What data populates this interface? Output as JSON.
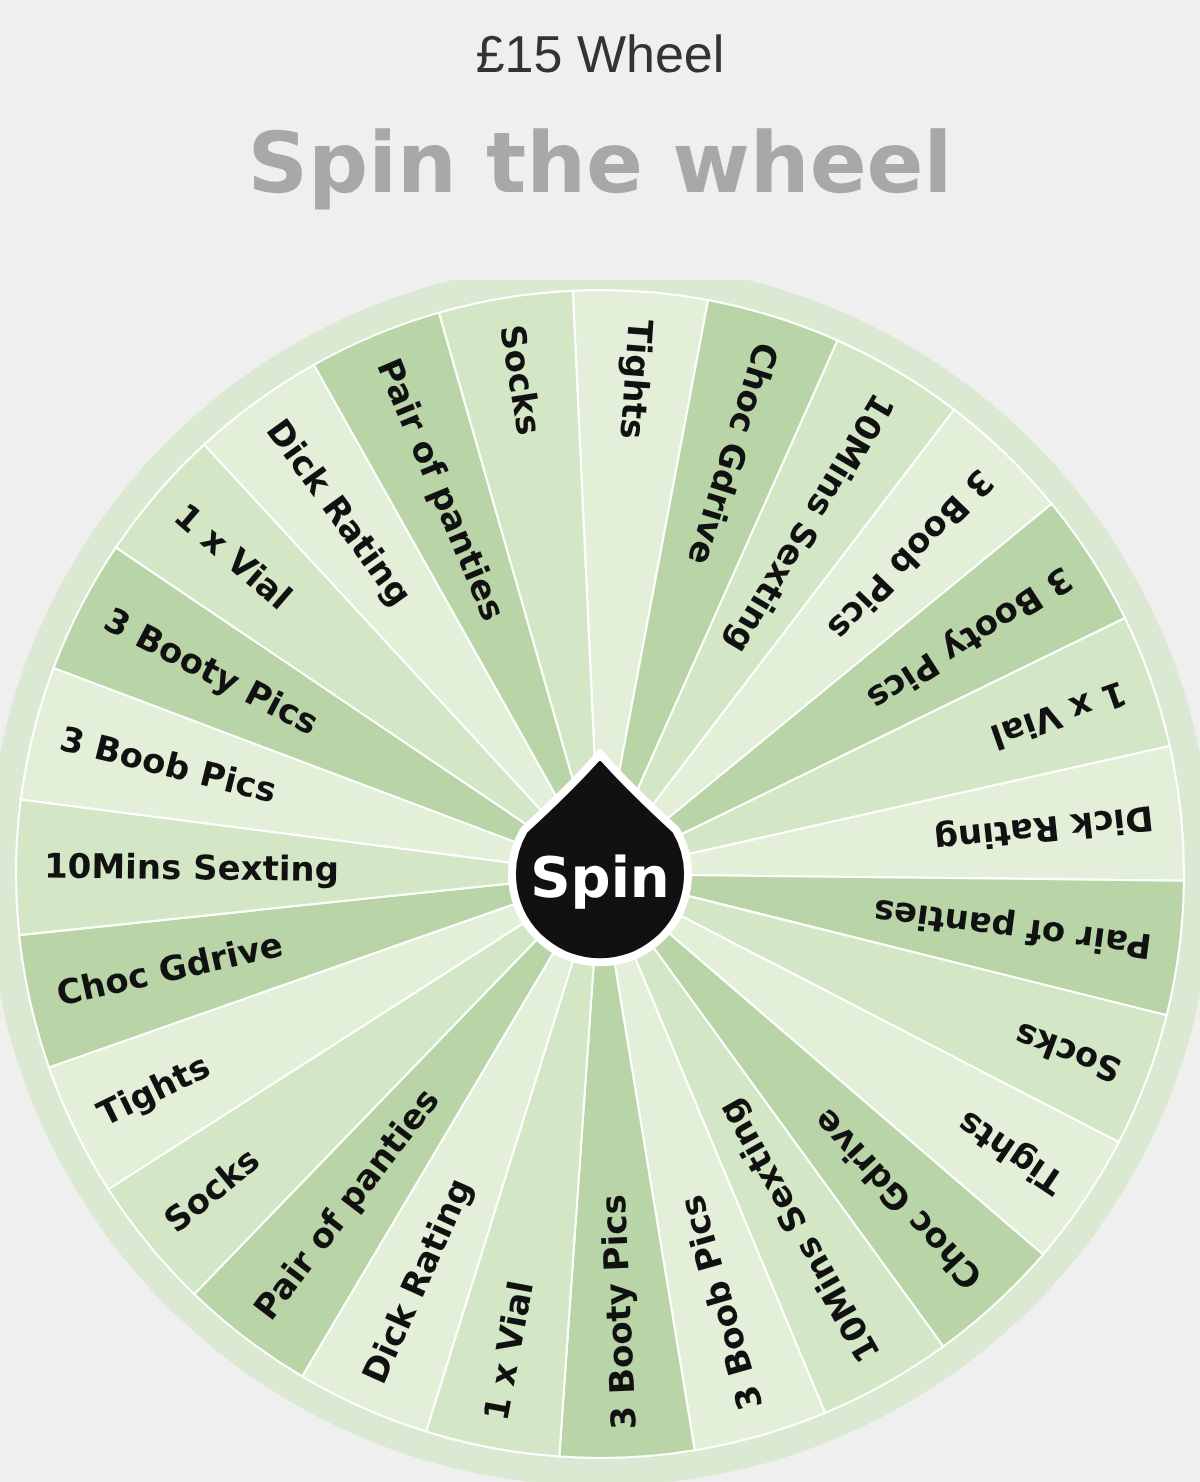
{
  "title": "£15 Wheel",
  "heading": "Spin the wheel",
  "wheel": {
    "spin_button": "Spin",
    "segments": [
      {
        "label": "Tights"
      },
      {
        "label": "Choc Gdrive"
      },
      {
        "label": "10Mins Sexting"
      },
      {
        "label": "3 Boob Pics"
      },
      {
        "label": "3 Booty Pics"
      },
      {
        "label": "1 x Vial"
      },
      {
        "label": "Dick Rating"
      },
      {
        "label": "Pair of panties"
      },
      {
        "label": "Socks"
      },
      {
        "label": "Tights"
      },
      {
        "label": "Choc Gdrive"
      },
      {
        "label": "10Mins Sexting"
      },
      {
        "label": "3 Boob Pics"
      },
      {
        "label": "3 Booty Pics"
      },
      {
        "label": "1 x Vial"
      },
      {
        "label": "Dick Rating"
      },
      {
        "label": "Pair of panties"
      },
      {
        "label": "Socks"
      },
      {
        "label": "Tights"
      },
      {
        "label": "Choc Gdrive"
      },
      {
        "label": "10Mins Sexting"
      },
      {
        "label": "3 Boob Pics"
      },
      {
        "label": "3 Booty Pics"
      },
      {
        "label": "1 x Vial"
      },
      {
        "label": "Dick Rating"
      },
      {
        "label": "Pair of panties"
      },
      {
        "label": "Socks"
      }
    ]
  }
}
